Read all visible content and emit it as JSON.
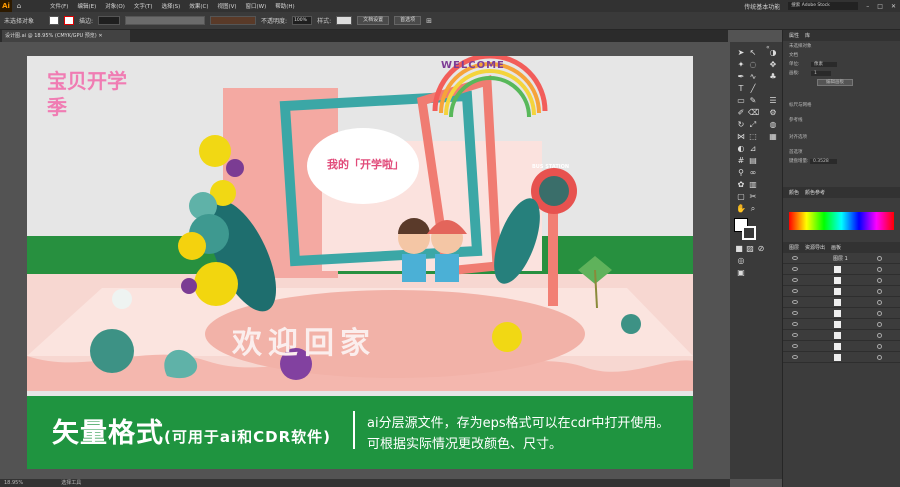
{
  "menubar": {
    "logo": "Ai",
    "items": [
      "文件(F)",
      "编辑(E)",
      "对象(O)",
      "文字(T)",
      "选择(S)",
      "效果(C)",
      "视图(V)",
      "窗口(W)",
      "帮助(H)"
    ],
    "workspace": "传统基本功能",
    "search_placeholder": "搜索 Adobe Stock"
  },
  "control": {
    "selection": "未选择对象",
    "stroke_label": "描边:",
    "opacity_label": "不透明度:",
    "opacity_value": "100%",
    "style_label": "样式:",
    "doc_setup": "文档设置",
    "preferences": "首选项"
  },
  "document": {
    "tab": "设计图.ai @ 18.95% (CMYK/GPU 预览)"
  },
  "artwork": {
    "welcome": "WELCOME",
    "bus": "BUS STATION",
    "bubble": "我的「开学啦」",
    "banner": "欢迎回家",
    "handwrite": "宝贝开学季",
    "bottom_title": "矢量格式",
    "bottom_sub": "(可用于ai和CDR软件)",
    "line1": "ai分层源文件，存为eps格式可以在cdr中打开使用。",
    "line2": "可根据实际情况更改颜色、尺寸。"
  },
  "panels": {
    "properties": "属性",
    "library": "库",
    "no_selection": "未选择对象",
    "doc": "文档",
    "unit_label": "单位:",
    "unit": "像素",
    "artboard_label": "画板:",
    "artboard": "1",
    "edit_artboard": "编辑画板",
    "ruler": "标尺与网格",
    "guides": "参考线",
    "align": "对齐选项",
    "prefs": "首选项",
    "keyboard_label": "键盘增量:",
    "keyboard": "0.3528",
    "color": "颜色",
    "color_guide": "颜色参考",
    "layers": "图层",
    "assets": "资源导出",
    "artboards": "画板",
    "layer1": "图层 1"
  },
  "status": {
    "zoom": "18.95%",
    "tool": "选择工具"
  }
}
